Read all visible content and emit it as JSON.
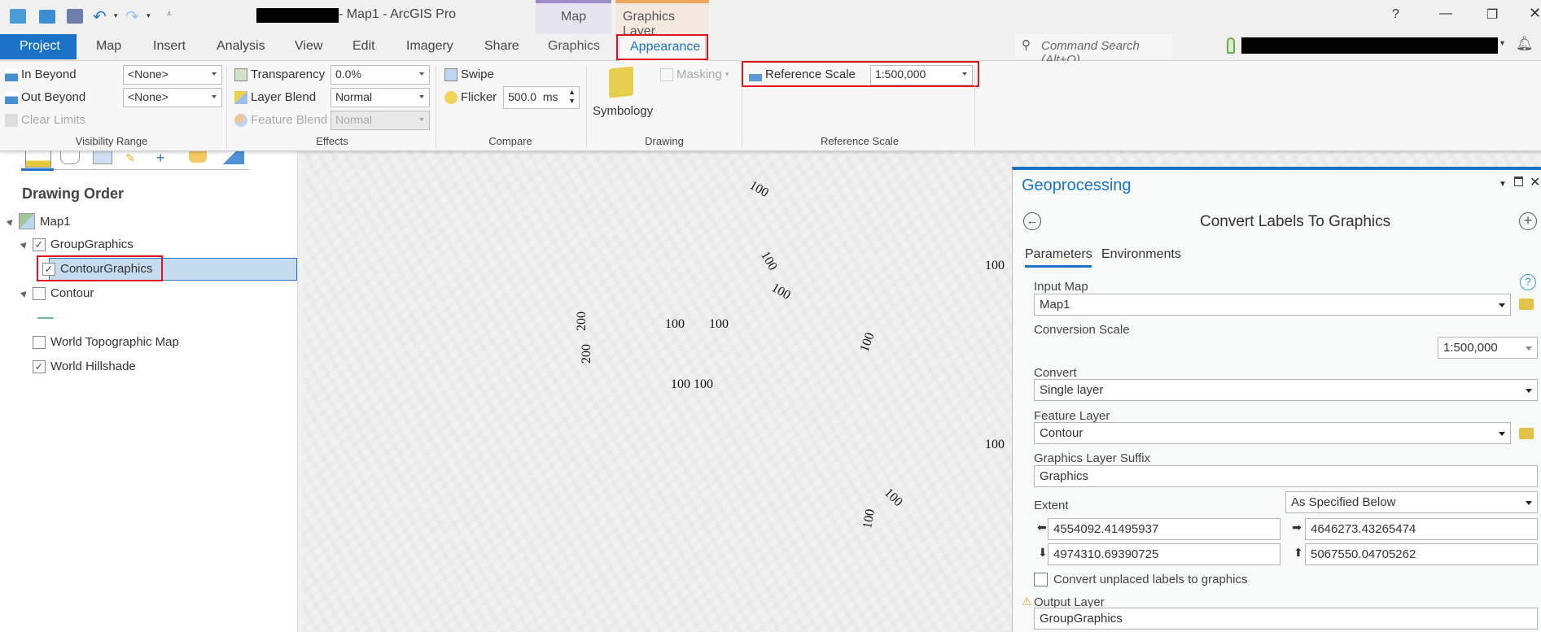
{
  "title_bar": {
    "title": "- Map1 - ArcGIS Pro",
    "help": "?",
    "contextual_map": "Map",
    "contextual_graphics_layer": "Graphics Layer"
  },
  "tabs": [
    "Project",
    "Map",
    "Insert",
    "Analysis",
    "View",
    "Edit",
    "Imagery",
    "Share",
    "Graphics",
    "Appearance"
  ],
  "search": {
    "placeholder": "Command Search (Alt+Q)"
  },
  "ribbon": {
    "visibility": {
      "in_beyond": "In Beyond",
      "out_beyond": "Out Beyond",
      "clear_limits": "Clear Limits",
      "in_value": "<None>",
      "out_value": "<None>",
      "group": "Visibility Range"
    },
    "effects": {
      "transparency": "Transparency",
      "transparency_value": "0.0%",
      "layer_blend": "Layer Blend",
      "layer_blend_value": "Normal",
      "feature_blend": "Feature Blend",
      "feature_blend_value": "Normal",
      "group": "Effects"
    },
    "compare": {
      "swipe": "Swipe",
      "flicker": "Flicker",
      "flicker_value": "500.0",
      "flicker_unit": "ms",
      "group": "Compare"
    },
    "drawing": {
      "symbology": "Symbology",
      "masking": "Masking",
      "group": "Drawing"
    },
    "reference_scale": {
      "label": "Reference Scale",
      "value": "1:500,000",
      "group": "Reference Scale"
    }
  },
  "contents": {
    "heading": "Drawing Order",
    "items": [
      {
        "label": "Map1"
      },
      {
        "label": "GroupGraphics",
        "checked": true
      },
      {
        "label": "ContourGraphics",
        "checked": true,
        "selected": true
      },
      {
        "label": "Contour",
        "checked": false
      },
      {
        "label": "World Topographic Map",
        "checked": false
      },
      {
        "label": "World Hillshade",
        "checked": true
      }
    ]
  },
  "map_labels": [
    "100",
    "100",
    "100",
    "200",
    "200",
    "100",
    "100",
    "100",
    "100 100",
    "100",
    "100",
    "100",
    "100"
  ],
  "geoprocessing": {
    "pane_title": "Geoprocessing",
    "tool_title": "Convert Labels To Graphics",
    "tab_parameters": "Parameters",
    "tab_environments": "Environments",
    "input_map_label": "Input Map",
    "input_map": "Map1",
    "conversion_scale_label": "Conversion Scale",
    "conversion_scale": "1:500,000",
    "convert_label": "Convert",
    "convert": "Single layer",
    "feature_layer_label": "Feature Layer",
    "feature_layer": "Contour",
    "suffix_label": "Graphics Layer Suffix",
    "suffix": "Graphics",
    "extent_label": "Extent",
    "extent_mode": "As Specified Below",
    "extent_left": "4554092.41495937",
    "extent_right": "4646273.43265474",
    "extent_bottom": "4974310.69390725",
    "extent_top": "5067550.04705262",
    "unplaced_label": "Convert unplaced labels to graphics",
    "unplaced_checked": false,
    "output_layer_label": "Output Layer",
    "output_layer": "GroupGraphics"
  },
  "colors": {
    "accent": "#1a73c7",
    "highlight": "#e0141e",
    "selected_row": "#c5dcef"
  }
}
